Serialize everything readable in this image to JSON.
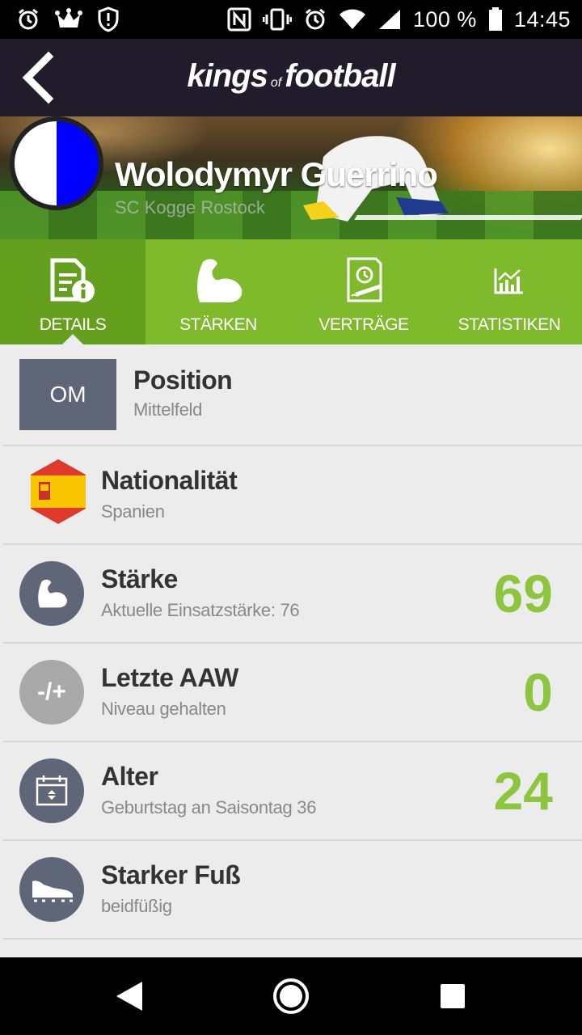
{
  "status_bar": {
    "battery_text": "100 %",
    "time": "14:45",
    "icons_left": [
      "alarm-icon",
      "crown-icon",
      "shield-alert-icon"
    ],
    "icons_right": [
      "nfc-icon",
      "vibrate-icon",
      "alarm-icon",
      "wifi-icon",
      "signal-icon",
      "battery-icon"
    ]
  },
  "app_bar": {
    "logo_part1": "kings",
    "logo_part2": "of",
    "logo_part3": "football"
  },
  "player": {
    "name": "Wolodymyr Guerrino",
    "club": "SC Kogge Rostock",
    "crest_colors": [
      "#ffffff",
      "#0000ff"
    ]
  },
  "tabs": [
    {
      "label": "DETAILS",
      "icon": "details-document-icon",
      "active": true
    },
    {
      "label": "STÄRKEN",
      "icon": "muscle-arm-icon",
      "active": false
    },
    {
      "label": "VERTRÄGE",
      "icon": "contract-icon",
      "active": false
    },
    {
      "label": "STATISTIKEN",
      "icon": "chart-icon",
      "active": false
    }
  ],
  "details": {
    "position": {
      "badge": "OM",
      "title": "Position",
      "sub": "Mittelfeld"
    },
    "nationality": {
      "title": "Nationalität",
      "sub": "Spanien",
      "icon": "spain-flag-icon"
    },
    "strength": {
      "title": "Stärke",
      "sub": "Aktuelle Einsatzstärke: 76",
      "value": "69",
      "icon": "muscle-arm-icon"
    },
    "last_aaw": {
      "title": "Letzte AAW",
      "sub": "Niveau gehalten",
      "value": "0",
      "icon_text": "-/+"
    },
    "age": {
      "title": "Alter",
      "sub": "Geburtstag an Saisontag 36",
      "value": "24",
      "icon": "calendar-icon"
    },
    "foot": {
      "title": "Starker Fuß",
      "sub": "beidfüßig",
      "icon": "football-boot-icon"
    }
  },
  "colors": {
    "accent_green": "#8dc53f",
    "tab_bg": "#7fb92c",
    "tab_active": "#64a01e",
    "app_bar": "#221b2b",
    "icon_bg": "#5f6678"
  }
}
